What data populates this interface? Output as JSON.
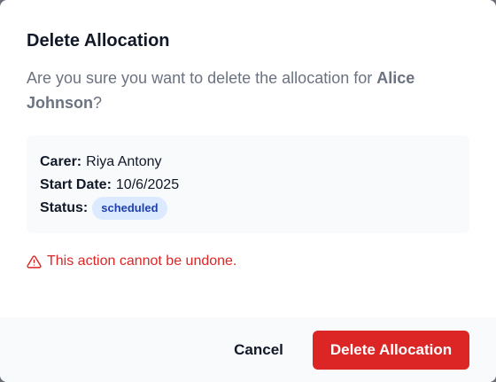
{
  "dialog": {
    "title": "Delete Allocation",
    "message_prefix": "Are you sure you want to delete the allocation for ",
    "client_name": "Alice Johnson",
    "message_suffix": "?",
    "details": {
      "carer_label": "Carer:",
      "carer_value": "Riya Antony",
      "start_label": "Start Date:",
      "start_value": "10/6/2025",
      "status_label": "Status:",
      "status_value": "scheduled"
    },
    "warning_icon": "alert-triangle-icon",
    "warning_text": "This action cannot be undone.",
    "cancel_label": "Cancel",
    "delete_label": "Delete Allocation"
  },
  "colors": {
    "danger": "#dc2626",
    "badge_bg": "#dbeafe",
    "badge_text": "#1e40af"
  }
}
